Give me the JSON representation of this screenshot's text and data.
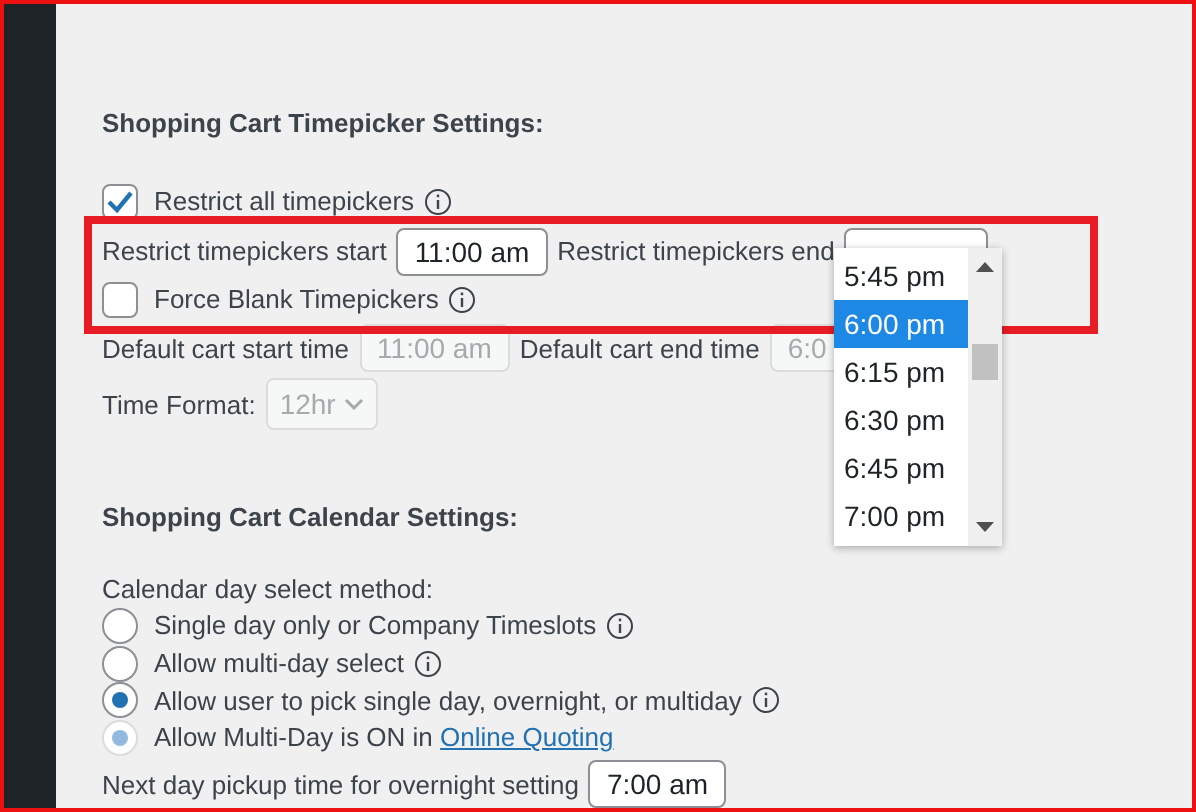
{
  "timepicker": {
    "heading": "Shopping Cart Timepicker Settings:",
    "restrict_all": {
      "label": "Restrict all timepickers",
      "checked": true
    },
    "start": {
      "label": "Restrict timepickers start",
      "value": "11:00 am"
    },
    "end": {
      "label": "Restrict timepickers end"
    },
    "force_blank": {
      "label": "Force Blank Timepickers",
      "checked": false
    },
    "default_start": {
      "label": "Default cart start time",
      "value": "11:00 am",
      "disabled": true
    },
    "default_end": {
      "label": "Default cart end time",
      "value": "6:0",
      "disabled": true
    },
    "time_format": {
      "label": "Time Format:",
      "value": "12hr",
      "disabled": true
    },
    "dropdown": [
      {
        "label": "5:45 pm",
        "selected": false
      },
      {
        "label": "6:00 pm",
        "selected": true
      },
      {
        "label": "6:15 pm",
        "selected": false
      },
      {
        "label": "6:30 pm",
        "selected": false
      },
      {
        "label": "6:45 pm",
        "selected": false
      },
      {
        "label": "7:00 pm",
        "selected": false
      }
    ]
  },
  "calendar": {
    "heading": "Shopping Cart Calendar Settings:",
    "method_label": "Calendar day select method:",
    "options": [
      {
        "label": "Single day only or Company Timeslots",
        "selected": false,
        "disabled": false,
        "info": true
      },
      {
        "label": "Allow multi-day select",
        "selected": false,
        "disabled": false,
        "info": true
      },
      {
        "label": "Allow user to pick single day, overnight, or multiday",
        "selected": true,
        "disabled": false,
        "info": true
      },
      {
        "label": "Allow Multi-Day is ON in ",
        "link": "Online Quoting",
        "selected": true,
        "disabled": true,
        "info": false
      }
    ],
    "next_day": {
      "label": "Next day pickup time for overnight setting",
      "value": "7:00 am"
    }
  }
}
